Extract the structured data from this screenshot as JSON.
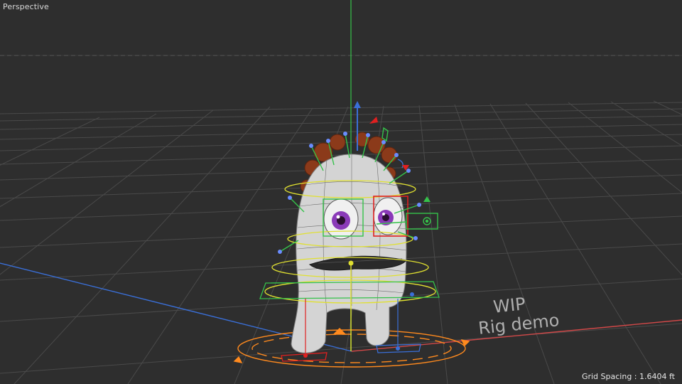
{
  "viewport": {
    "name": "Perspective",
    "grid_spacing_label": "Grid Spacing",
    "grid_spacing_value": "1.6404 ft"
  },
  "watermark": {
    "line1": "WIP",
    "line2": "Rig demo"
  },
  "colors": {
    "background": "#2e2e2e",
    "grid_line": "#4a4a4a",
    "axis_x": "#d04848",
    "axis_z": "#3a6fd8",
    "axis_y": "#35c24a",
    "control_yellow": "#e0e030",
    "control_green": "#35c24a",
    "control_orange": "#ff8a1e",
    "control_red": "#e02020",
    "mesh": "#d8d8d8",
    "hair": "#8b3a1a",
    "iris": "#8a3ab8"
  },
  "icons": [
    "character-model",
    "rig-controls",
    "transform-gizmo"
  ]
}
